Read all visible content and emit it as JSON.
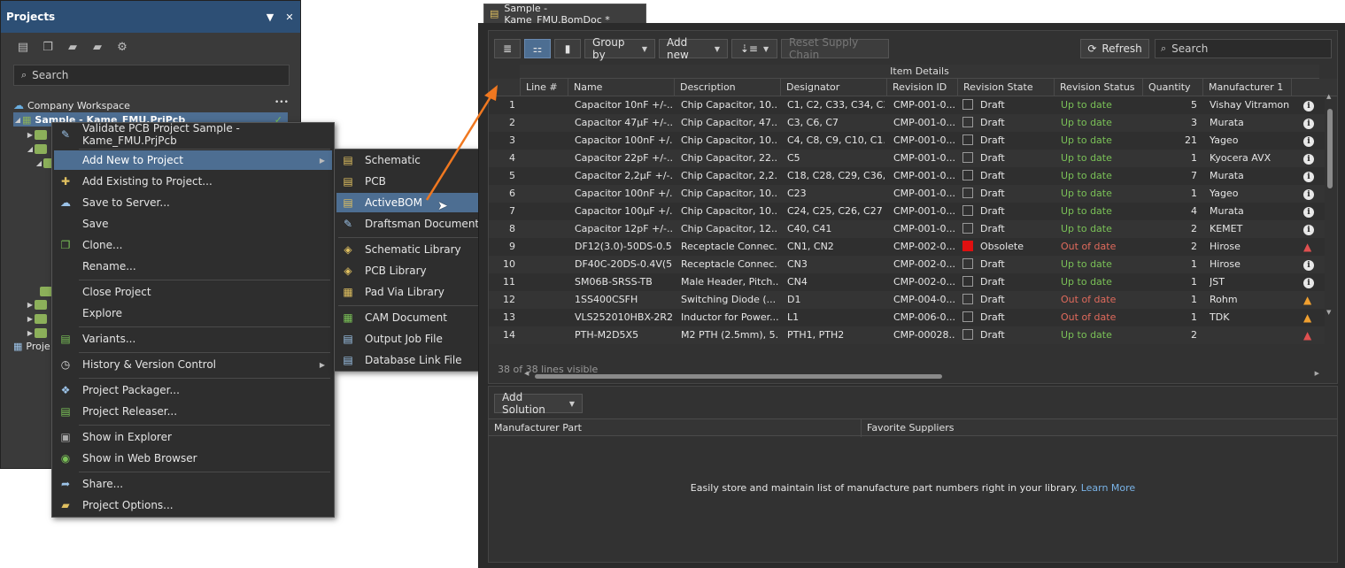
{
  "projects_panel": {
    "title": "Projects",
    "search_placeholder": "Search",
    "workspace": "Company Workspace",
    "workspace_more": "•••",
    "project": "Sample - Kame_FMU.PrjPcb",
    "project_partial": "Proje"
  },
  "context_menu": {
    "items": [
      {
        "label": "Validate PCB Project Sample - Kame_FMU.PrjPcb",
        "icon": "validate-icon"
      },
      {
        "label": "Add New to Project",
        "icon": "",
        "submenu": true
      },
      {
        "label": "Add Existing to Project...",
        "icon": "add-existing-icon"
      },
      {
        "label": "Save to Server...",
        "icon": "save-server-icon"
      },
      {
        "label": "Save",
        "icon": ""
      },
      {
        "label": "Clone...",
        "icon": "clone-icon"
      },
      {
        "label": "Rename...",
        "icon": ""
      },
      {
        "label": "Close Project",
        "icon": ""
      },
      {
        "label": "Explore",
        "icon": ""
      },
      {
        "label": "Variants...",
        "icon": "variants-icon"
      },
      {
        "label": "History & Version Control",
        "icon": "history-icon",
        "submenu": true
      },
      {
        "label": "Project Packager...",
        "icon": "packager-icon"
      },
      {
        "label": "Project Releaser...",
        "icon": "releaser-icon"
      },
      {
        "label": "Show in Explorer",
        "icon": "explorer-icon"
      },
      {
        "label": "Show in Web Browser",
        "icon": "web-browser-icon"
      },
      {
        "label": "Share...",
        "icon": "share-icon"
      },
      {
        "label": "Project Options...",
        "icon": "options-icon"
      }
    ]
  },
  "submenu": {
    "items": [
      {
        "label": "Schematic",
        "icon": "schematic-icon"
      },
      {
        "label": "PCB",
        "icon": "pcb-icon"
      },
      {
        "label": "ActiveBOM",
        "icon": "activebom-icon"
      },
      {
        "label": "Draftsman Document",
        "icon": "draftsman-icon"
      },
      {
        "label": "Schematic Library",
        "icon": "schlib-icon"
      },
      {
        "label": "PCB Library",
        "icon": "pcblib-icon"
      },
      {
        "label": "Pad Via Library",
        "icon": "padvia-icon"
      },
      {
        "label": "CAM Document",
        "icon": "cam-icon"
      },
      {
        "label": "Output Job File",
        "icon": "outjob-icon"
      },
      {
        "label": "Database Link File",
        "icon": "dblink-icon"
      }
    ]
  },
  "bom": {
    "tab_title": "Sample - Kame_FMU.BomDoc *",
    "toolbar": {
      "group_by": "Group by",
      "add_new": "Add new",
      "reset_supply_chain": "Reset Supply Chain",
      "refresh": "Refresh",
      "search_placeholder": "Search"
    },
    "group_header": "Item Details",
    "columns": [
      "Line #",
      "Name",
      "Description",
      "Designator",
      "Revision ID",
      "Revision State",
      "Revision Status",
      "Quantity",
      "Manufacturer 1"
    ],
    "rows": [
      {
        "n": "1",
        "name": "Capacitor 10nF +/-...",
        "desc": "Chip Capacitor, 10...",
        "des": "C1, C2, C33, C34, C35",
        "rev": "CMP-001-0...",
        "state": "Draft",
        "status": "Up to date",
        "qty": "5",
        "mfr": "Vishay Vitramon",
        "flag": "info"
      },
      {
        "n": "2",
        "name": "Capacitor 47µF +/-...",
        "desc": "Chip Capacitor, 47...",
        "des": "C3, C6, C7",
        "rev": "CMP-001-0...",
        "state": "Draft",
        "status": "Up to date",
        "qty": "3",
        "mfr": "Murata",
        "flag": "info"
      },
      {
        "n": "3",
        "name": "Capacitor 100nF +/...",
        "desc": "Chip Capacitor, 10...",
        "des": "C4, C8, C9, C10, C1...",
        "rev": "CMP-001-0...",
        "state": "Draft",
        "status": "Up to date",
        "qty": "21",
        "mfr": "Yageo",
        "flag": "info"
      },
      {
        "n": "4",
        "name": "Capacitor 22pF +/-...",
        "desc": "Chip Capacitor, 22...",
        "des": "C5",
        "rev": "CMP-001-0...",
        "state": "Draft",
        "status": "Up to date",
        "qty": "1",
        "mfr": "Kyocera AVX",
        "flag": "info"
      },
      {
        "n": "5",
        "name": "Capacitor 2,2µF +/-...",
        "desc": "Chip Capacitor, 2,2...",
        "des": "C18, C28, C29, C36,...",
        "rev": "CMP-001-0...",
        "state": "Draft",
        "status": "Up to date",
        "qty": "7",
        "mfr": "Murata",
        "flag": "info"
      },
      {
        "n": "6",
        "name": "Capacitor 100nF +/...",
        "desc": "Chip Capacitor, 10...",
        "des": "C23",
        "rev": "CMP-001-0...",
        "state": "Draft",
        "status": "Up to date",
        "qty": "1",
        "mfr": "Yageo",
        "flag": "info"
      },
      {
        "n": "7",
        "name": "Capacitor 100µF +/...",
        "desc": "Chip Capacitor, 10...",
        "des": "C24, C25, C26, C27",
        "rev": "CMP-001-0...",
        "state": "Draft",
        "status": "Up to date",
        "qty": "4",
        "mfr": "Murata",
        "flag": "info"
      },
      {
        "n": "8",
        "name": "Capacitor 12pF +/-...",
        "desc": "Chip Capacitor, 12...",
        "des": "C40, C41",
        "rev": "CMP-001-0...",
        "state": "Draft",
        "status": "Up to date",
        "qty": "2",
        "mfr": "KEMET",
        "flag": "info"
      },
      {
        "n": "9",
        "name": "DF12(3.0)-50DS-0.5...",
        "desc": "Receptacle Connec...",
        "des": "CN1, CN2",
        "rev": "CMP-002-0...",
        "state": "Obsolete",
        "status": "Out of date",
        "qty": "2",
        "mfr": "Hirose",
        "flag": "warn-red"
      },
      {
        "n": "10",
        "name": "DF40C-20DS-0.4V(51)",
        "desc": "Receptacle Connec...",
        "des": "CN3",
        "rev": "CMP-002-0...",
        "state": "Draft",
        "status": "Up to date",
        "qty": "1",
        "mfr": "Hirose",
        "flag": "info"
      },
      {
        "n": "11",
        "name": "SM06B-SRSS-TB",
        "desc": "Male Header, Pitch...",
        "des": "CN4",
        "rev": "CMP-002-0...",
        "state": "Draft",
        "status": "Up to date",
        "qty": "1",
        "mfr": "JST",
        "flag": "info"
      },
      {
        "n": "12",
        "name": "1SS400CSFH",
        "desc": "Switching Diode (...",
        "des": "D1",
        "rev": "CMP-004-0...",
        "state": "Draft",
        "status": "Out of date",
        "qty": "1",
        "mfr": "Rohm",
        "flag": "warn-org"
      },
      {
        "n": "13",
        "name": "VLS252010HBX-2R2...",
        "desc": "Inductor for Power...",
        "des": "L1",
        "rev": "CMP-006-0...",
        "state": "Draft",
        "status": "Out of date",
        "qty": "1",
        "mfr": "TDK",
        "flag": "warn-org"
      },
      {
        "n": "14",
        "name": "PTH-M2D5X5",
        "desc": "M2 PTH (2.5mm), 5...",
        "des": "PTH1, PTH2",
        "rev": "CMP-00028...",
        "state": "Draft",
        "status": "Up to date",
        "qty": "2",
        "mfr": "",
        "flag": "warn-red"
      }
    ],
    "visible_count": "38 of 38 lines visible",
    "solutions": {
      "add_solution": "Add Solution",
      "col_mfr_part": "Manufacturer Part",
      "col_fav_suppliers": "Favorite Suppliers",
      "empty_message": "Easily store and maintain list of manufacture part numbers right in your library.",
      "learn_more": "Learn More"
    }
  },
  "colors": {
    "accent": "#4d6e92",
    "header": "#2d4f75",
    "ok": "#7ac157",
    "bad": "#e06a5c",
    "arrow": "#f07820"
  }
}
